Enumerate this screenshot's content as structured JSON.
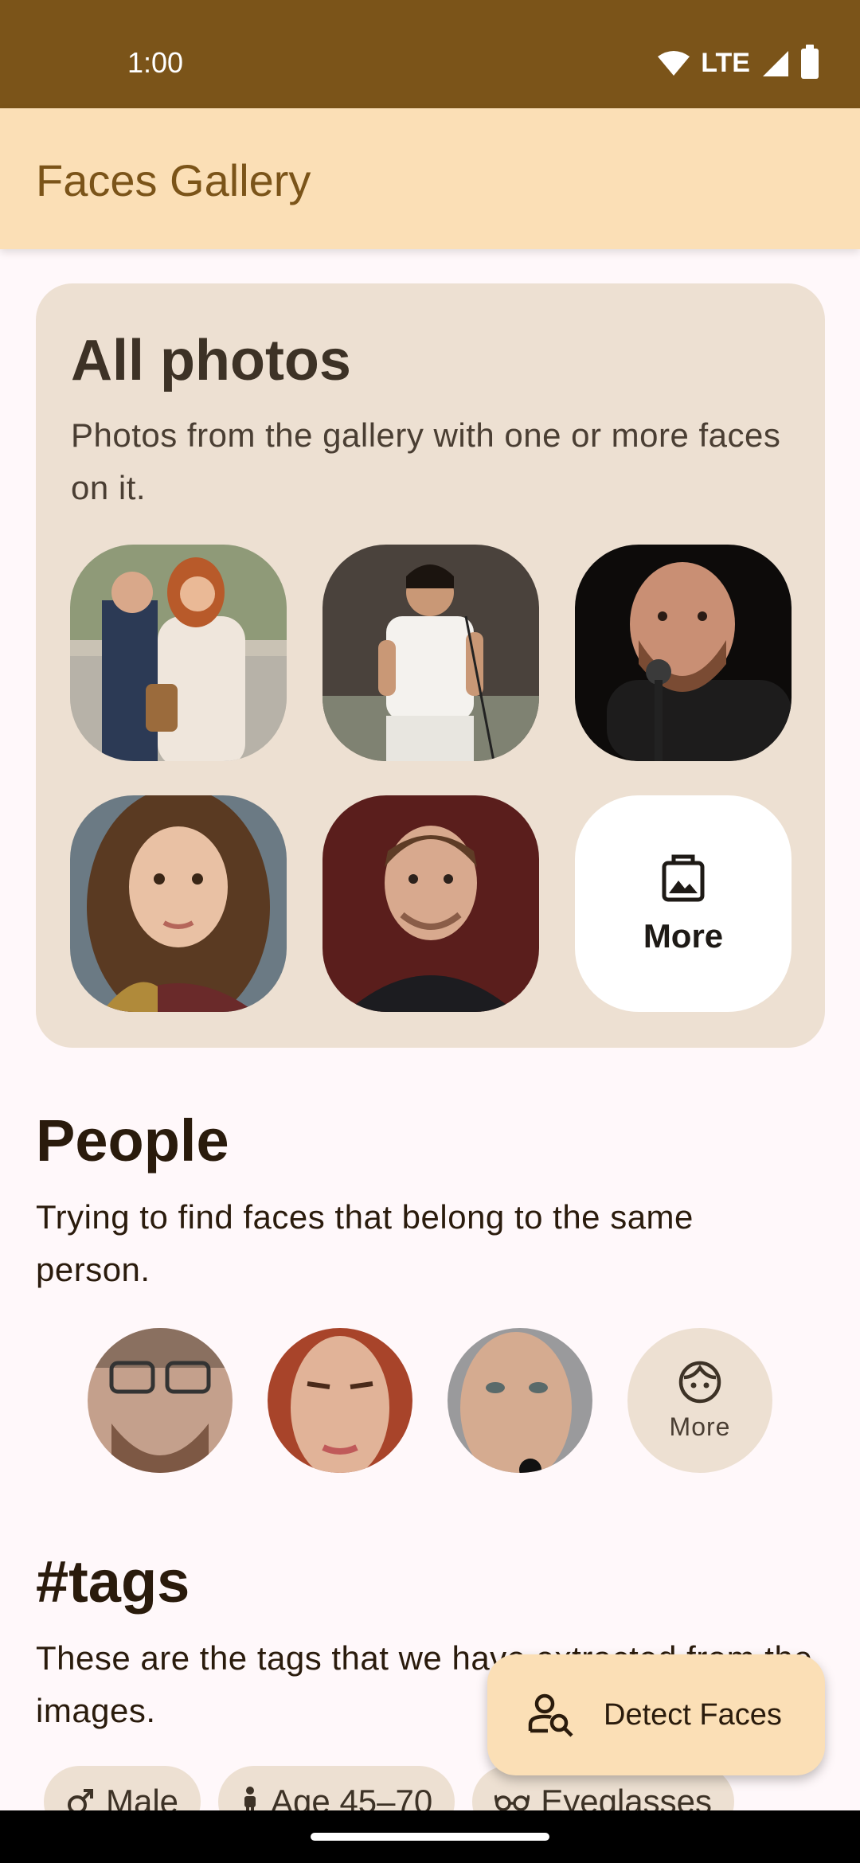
{
  "status_bar": {
    "time": "1:00",
    "network": "LTE"
  },
  "app_bar": {
    "title": "Faces Gallery"
  },
  "all_photos": {
    "title": "All photos",
    "subtitle": "Photos from the gallery with one or more faces on it.",
    "more_label": "More",
    "more_icon": "image-icon"
  },
  "people": {
    "title": "People",
    "subtitle": "Trying to find faces that belong to the same person.",
    "more_label": "More",
    "more_icon": "face-icon"
  },
  "tags": {
    "title": "#tags",
    "subtitle": "These are the tags that we have extracted from the images.",
    "chips": [
      {
        "label": "Male",
        "icon": "male-icon"
      },
      {
        "label": "Age 45–70",
        "icon": "person-icon"
      },
      {
        "label": "Eyeglasses",
        "icon": "eyeglasses-icon"
      }
    ]
  },
  "fab": {
    "label": "Detect Faces",
    "icon": "person-search-icon"
  },
  "colors": {
    "status_bar": "#7b5419",
    "app_bar": "#fbdfb6",
    "card": "#ede0d2"
  }
}
